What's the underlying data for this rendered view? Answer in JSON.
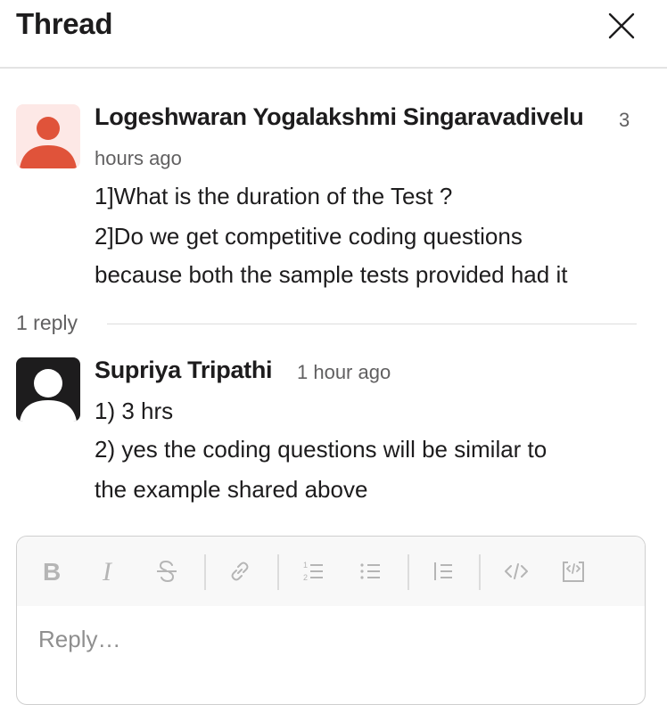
{
  "header": {
    "title": "Thread",
    "close_icon": "close-icon"
  },
  "messages": [
    {
      "author": "Logeshwaran Yogalakshmi Singaravadivelu",
      "time_part1": "3",
      "time_part2": "hours ago",
      "avatar_bg": "#fde8e6",
      "avatar_fg": "#e0533a",
      "lines": [
        "1]What is the duration of the Test ?",
        "2]Do we get competitive coding questions",
        "because both the sample tests provided had it"
      ]
    },
    {
      "author": "Supriya Tripathi",
      "time": "1 hour ago",
      "avatar_bg": "#1d1c1d",
      "avatar_fg": "#ffffff",
      "lines": [
        "1) 3 hrs",
        "2) yes the coding questions will be similar to",
        "the example shared above"
      ]
    }
  ],
  "replies": {
    "count_label": "1 reply"
  },
  "composer": {
    "placeholder": "Reply…",
    "toolbar": [
      "bold-icon",
      "italic-icon",
      "strikethrough-icon",
      "link-icon",
      "ordered-list-icon",
      "bulleted-list-icon",
      "blockquote-icon",
      "code-icon",
      "code-block-icon"
    ],
    "colors": {
      "toolbar_bg": "#f8f8f8",
      "icon": "#b5b5b5",
      "border": "#cfcfcf"
    }
  }
}
